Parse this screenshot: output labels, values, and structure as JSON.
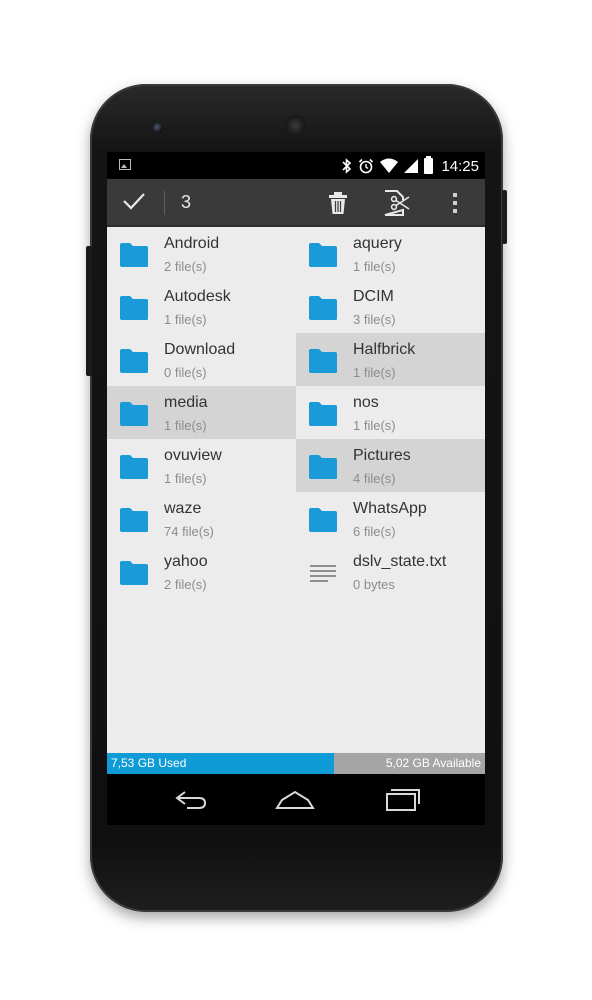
{
  "status_bar": {
    "time": "14:25",
    "icons": [
      "image-notification-icon",
      "bluetooth-icon",
      "alarm-icon",
      "wifi-icon",
      "signal-icon",
      "battery-icon"
    ]
  },
  "action_bar": {
    "selected_count": "3",
    "actions": [
      "done-check-icon",
      "delete-icon",
      "cut-icon",
      "overflow-menu-icon"
    ]
  },
  "files": [
    {
      "name": "Android",
      "sub": "2 file(s)",
      "type": "folder",
      "selected": false
    },
    {
      "name": "aquery",
      "sub": "1 file(s)",
      "type": "folder",
      "selected": false
    },
    {
      "name": "Autodesk",
      "sub": "1 file(s)",
      "type": "folder",
      "selected": false
    },
    {
      "name": "DCIM",
      "sub": "3 file(s)",
      "type": "folder",
      "selected": false
    },
    {
      "name": "Download",
      "sub": "0 file(s)",
      "type": "folder",
      "selected": false
    },
    {
      "name": "Halfbrick",
      "sub": "1 file(s)",
      "type": "folder",
      "selected": true
    },
    {
      "name": "media",
      "sub": "1 file(s)",
      "type": "folder",
      "selected": true
    },
    {
      "name": "nos",
      "sub": "1 file(s)",
      "type": "folder",
      "selected": false
    },
    {
      "name": "ovuview",
      "sub": "1 file(s)",
      "type": "folder",
      "selected": false
    },
    {
      "name": "Pictures",
      "sub": "4 file(s)",
      "type": "folder",
      "selected": true
    },
    {
      "name": "waze",
      "sub": "74 file(s)",
      "type": "folder",
      "selected": false
    },
    {
      "name": "WhatsApp",
      "sub": "6 file(s)",
      "type": "folder",
      "selected": false
    },
    {
      "name": "yahoo",
      "sub": "2 file(s)",
      "type": "folder",
      "selected": false
    },
    {
      "name": "dslv_state.txt",
      "sub": "0 bytes",
      "type": "text-file",
      "selected": false
    }
  ],
  "storage": {
    "used_label": "7,53 GB Used",
    "available_label": "5,02 GB Available",
    "used_fraction": 0.6
  },
  "colors": {
    "folder": "#1a9bd7",
    "used_bar": "#0e9bd6",
    "selected_row": "#d4d4d4"
  },
  "nav_bar": [
    "back-icon",
    "home-icon",
    "recents-icon"
  ]
}
